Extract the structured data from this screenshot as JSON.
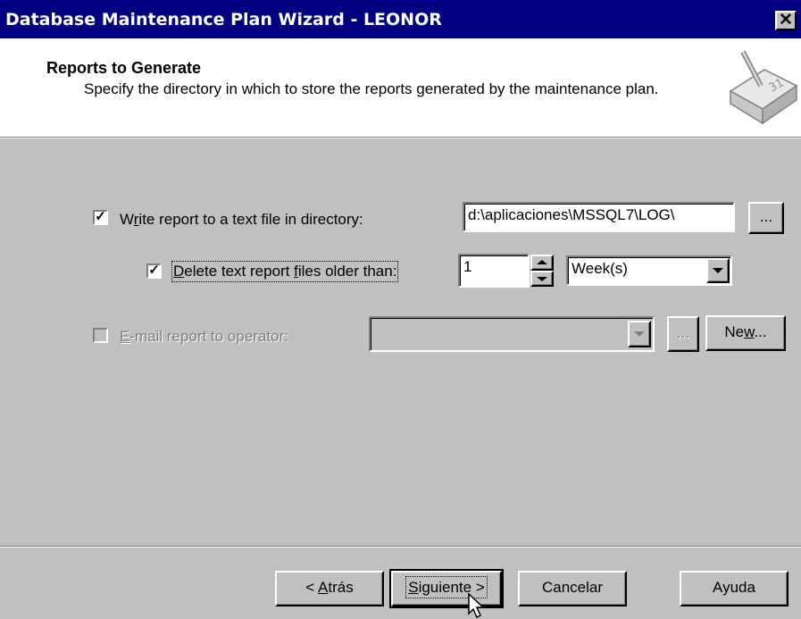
{
  "window": {
    "title": "Database Maintenance Plan Wizard - LEONOR",
    "close_label": "✕"
  },
  "header": {
    "title": "Reports to Generate",
    "subtitle": "Specify the directory in which to store the reports generated by the maintenance plan."
  },
  "write_report": {
    "label_pre": "W",
    "label_u": "r",
    "label_post": "ite report to a text file in directory:",
    "checked_mark": "✓",
    "directory": "d:\\aplicaciones\\MSSQL7\\LOG\\",
    "browse_label": "..."
  },
  "delete_old": {
    "label_u": "D",
    "label_mid": "elete text report ",
    "label_u2": "f",
    "label_post": "iles older than:",
    "checked_mark": "✓",
    "count": "1",
    "unit": "Week(s)"
  },
  "email_report": {
    "label_u": "E",
    "label_post": "-mail report to operator:",
    "operator": "",
    "browse_label": "...",
    "new_pre": "Ne",
    "new_u": "w",
    "new_post": "..."
  },
  "footer": {
    "back_pre": "< ",
    "back_u": "A",
    "back_post": "trás",
    "next_u": "S",
    "next_post": "iguiente >",
    "cancel": "Cancelar",
    "help": "Ayuda"
  }
}
